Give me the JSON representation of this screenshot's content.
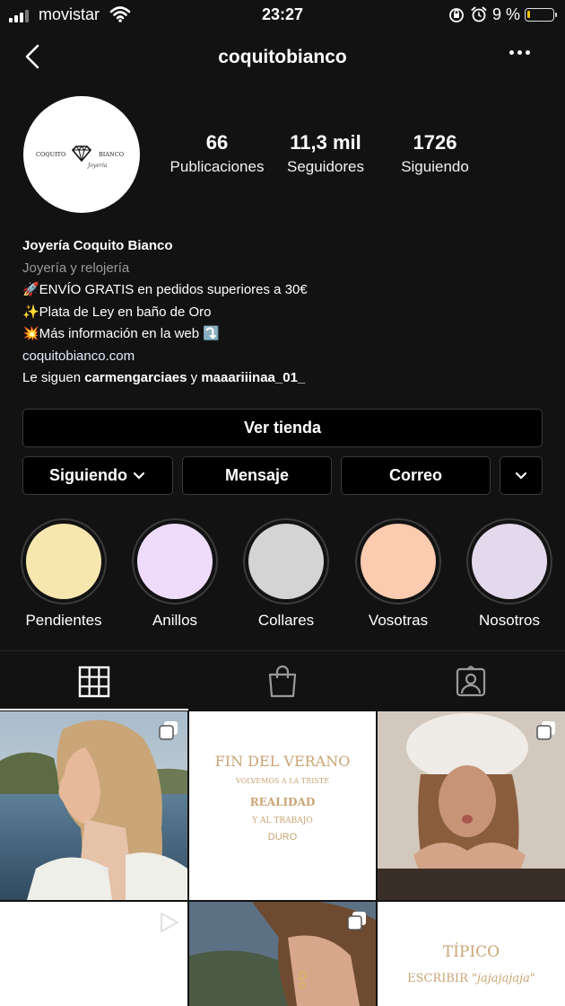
{
  "status_bar": {
    "carrier": "movistar",
    "time": "23:27",
    "battery": "9 %",
    "battery_level": 0.09
  },
  "header": {
    "username": "coquitobianco",
    "back_icon": "chevron-left-icon",
    "more_icon": "ellipsis-icon"
  },
  "avatar": {
    "logo_text": "COQUITO BIANCO",
    "logo_subtext": "Joyería"
  },
  "stats": [
    {
      "value": "66",
      "label": "Publicaciones"
    },
    {
      "value": "11,3 mil",
      "label": "Seguidores"
    },
    {
      "value": "1726",
      "label": "Siguiendo"
    }
  ],
  "bio": {
    "name": "Joyería Coquito Bianco",
    "category": "Joyería y relojería",
    "lines": [
      "🚀ENVÍO GRATIS en pedidos superiores a 30€",
      "✨Plata de Ley en baño de Oro",
      "💥Más información en la web ⤵️"
    ],
    "link": "coquitobianco.com",
    "followed_prefix": "Le siguen",
    "followed_user1": "carmengarciaes",
    "followed_join": "y",
    "followed_user2": "maaariiinaa_01_"
  },
  "buttons": {
    "shop": "Ver tienda",
    "following": "Siguiendo",
    "message": "Mensaje",
    "email": "Correo"
  },
  "highlights": [
    {
      "label": "Pendientes",
      "color": "#f7e6ae"
    },
    {
      "label": "Anillos",
      "color": "#efdcfc"
    },
    {
      "label": "Collares",
      "color": "#d4d4d4"
    },
    {
      "label": "Vosotras",
      "color": "#fccbb0"
    },
    {
      "label": "Nosotros",
      "color": "#e3d9ec"
    }
  ],
  "tabs": [
    "grid-icon",
    "shop-bag-icon",
    "tagged-person-icon"
  ],
  "posts": {
    "post2": {
      "line1": "FIN DEL VERANO",
      "line2": "VOLVEMOS A LA TRISTE",
      "line3": "REALIDAD",
      "line4": "Y AL TRABAJO",
      "line5": "DURO"
    },
    "post6": {
      "line1": "TÍPICO",
      "line2": "ESCRIBIR",
      "line3": "\"jajajajaja\""
    }
  }
}
